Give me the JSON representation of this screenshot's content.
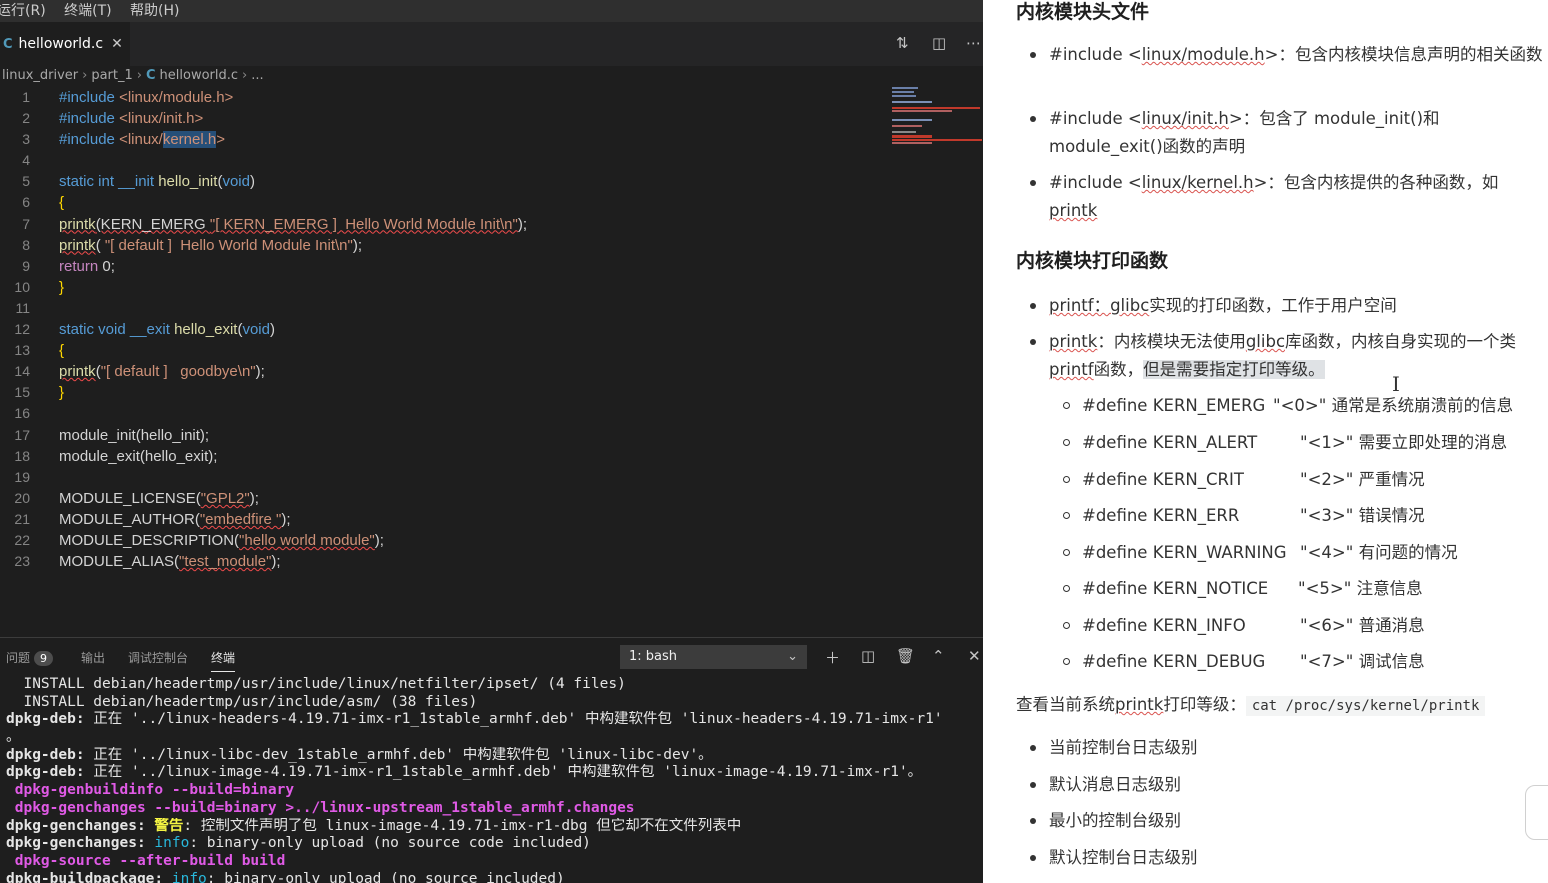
{
  "menubar": {
    "items": [
      "运行(R)",
      "终端(T)",
      "帮助(H)"
    ]
  },
  "editor": {
    "tab": {
      "icon": "C",
      "label": "helloworld.c",
      "close": "✕"
    },
    "breadcrumb": [
      "linux_driver",
      "part_1",
      "helloworld.c",
      "..."
    ],
    "line_numbers": [
      "1",
      "2",
      "3",
      "4",
      "5",
      "6",
      "7",
      "8",
      "9",
      "10",
      "11",
      "12",
      "13",
      "14",
      "15",
      "16",
      "17",
      "18",
      "19",
      "20",
      "21",
      "22",
      "23"
    ],
    "code": {
      "l1_kw": "#include",
      "l1_path": "<linux/module.h>",
      "l2_kw": "#include",
      "l2_path": "<linux/init.h>",
      "l3_kw": "#include",
      "l3_a": "<linux/",
      "l3_sel": "kernel.h",
      "l3_b": ">",
      "l5_kw": "static int __init",
      "l5_fn": "hello_init",
      "l5_p1": "(",
      "l5_void": "void",
      "l5_p2": ")",
      "l6": "{",
      "l7_fn": "printk",
      "l7_a": "(KERN_EMERG ",
      "l7_str": "\"[ KERN_EMERG ]  Hello World Module Init\\n\"",
      "l7_b": ");",
      "l8_fn": "printk",
      "l8_a": "( ",
      "l8_str": "\"[ default ]  Hello World Module Init\\n\"",
      "l8_b": ");",
      "l9_kw": "return",
      "l9_a": " 0;",
      "l10": "}",
      "l12_kw": "static void __exit",
      "l12_fn": "hello_exit",
      "l12_p1": "(",
      "l12_void": "void",
      "l12_p2": ")",
      "l13": "{",
      "l14_fn": "printk",
      "l14_a": "(",
      "l14_str": "\"[ default ]   goodbye\\n\"",
      "l14_b": ");",
      "l15": "}",
      "l17": "module_init(hello_init);",
      "l18": "module_exit(hello_exit);",
      "l20_a": "MODULE_LICENSE(",
      "l20_str": "\"GPL2\"",
      "l20_b": ");",
      "l21_a": "MODULE_AUTHOR(",
      "l21_str": "\"embedfire \"",
      "l21_b": ");",
      "l22_a": "MODULE_DESCRIPTION(",
      "l22_str": "\"hello world module\"",
      "l22_b": ");",
      "l23_a": "MODULE_ALIAS(",
      "l23_str": "\"test_module\"",
      "l23_b": ");"
    }
  },
  "panel": {
    "tabs": {
      "problems": "问题",
      "problems_count": "9",
      "output": "输出",
      "debug": "调试控制台",
      "terminal": "终端"
    },
    "terminal_select": "1: bash",
    "terminal_lines": {
      "t1": "  INSTALL debian/headertmp/usr/include/linux/netfilter/ipset/ (4 files)",
      "t2": "  INSTALL debian/headertmp/usr/include/asm/ (38 files)",
      "t3_a": "dpkg-deb:",
      "t3_b": " 正在 '../linux-headers-4.19.71-imx-r1_1stable_armhf.deb' 中构建软件包 'linux-headers-4.19.71-imx-r1'",
      "t4": "。",
      "t5_a": "dpkg-deb:",
      "t5_b": " 正在 '../linux-libc-dev_1stable_armhf.deb' 中构建软件包 'linux-libc-dev'。",
      "t6_a": "dpkg-deb:",
      "t6_b": " 正在 '../linux-image-4.19.71-imx-r1_1stable_armhf.deb' 中构建软件包 'linux-image-4.19.71-imx-r1'。",
      "t7": " dpkg-genbuildinfo --build=binary",
      "t8": " dpkg-genchanges --build=binary >../linux-upstream_1stable_armhf.changes",
      "t9_a": "dpkg-genchanges:",
      "t9_w": " 警告",
      "t9_b": ": 控制文件声明了包 linux-image-4.19.71-imx-r1-dbg 但它却不在文件列表中",
      "t10_a": "dpkg-genchanges:",
      "t10_i": " info",
      "t10_b": ": binary-only upload (no source code included)",
      "t11": " dpkg-source --after-build build",
      "t12_a": "dpkg-buildpackage:",
      "t12_i": " info",
      "t12_b": ": binary-only upload (no source included)"
    }
  },
  "doc": {
    "h1": "内核模块头文件",
    "inc1_a": "#include <",
    "inc1_u": "linux/module.h",
    "inc1_b": ">：包含内核模块信息声明的相关函数",
    "inc2_a": "#include <",
    "inc2_u": "linux/init.h",
    "inc2_b": ">：包含了 module_init()和 module_exit()函数的声明",
    "inc3_a": "#include <",
    "inc3_u": "linux/kernel.h",
    "inc3_b": ">：包含内核提供的各种函数，如 ",
    "inc3_u2": "printk",
    "h2": "内核模块打印函数",
    "pf_u": "printf：glibc",
    "pf_b": "实现的打印函数，工作于用户空间",
    "pk_u": "printk",
    "pk_a": "：内核模块无法使用",
    "pk_u2": "glibc",
    "pk_b": "库函数，内核自身实现的一个类",
    "pk_u3": "printf",
    "pk_c": "函数，",
    "pk_hl": "但是需要指定打印等级。",
    "levels": [
      {
        "name": "#define KERN_EMERG",
        "val": "\"<0>\" 通常是系统崩溃前的信息"
      },
      {
        "name": "#define KERN_ALERT",
        "val": "\"<1>\" 需要立即处理的消息"
      },
      {
        "name": "#define KERN_CRIT",
        "val": "\"<2>\" 严重情况"
      },
      {
        "name": "#define KERN_ERR",
        "val": "\"<3>\" 错误情况"
      },
      {
        "name": "#define KERN_WARNING",
        "val": "\"<4>\" 有问题的情况"
      },
      {
        "name": "#define KERN_NOTICE",
        "val": "\"<5>\" 注意信息"
      },
      {
        "name": "#define KERN_INFO",
        "val": "\"<6>\" 普通消息"
      },
      {
        "name": "#define KERN_DEBUG",
        "val": "\"<7>\" 调试信息"
      }
    ],
    "view_a": "查看当前系统",
    "view_u": "printk",
    "view_b": "打印等级：",
    "view_code": "cat /proc/sys/kernel/printk",
    "console_items": [
      "当前控制台日志级别",
      "默认消息日志级别",
      "最小的控制台级别",
      "默认控制台日志级别"
    ]
  }
}
